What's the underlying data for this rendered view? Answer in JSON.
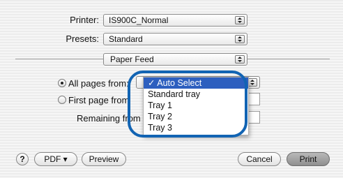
{
  "printer": {
    "label": "Printer:",
    "value": "IS900C_Normal"
  },
  "presets": {
    "label": "Presets:",
    "value": "Standard"
  },
  "panel": {
    "value": "Paper Feed"
  },
  "options": {
    "all_pages": "All pages from:",
    "first_page": "First page from",
    "remaining": "Remaining from"
  },
  "menu": {
    "items": [
      "✓ Auto Select",
      "Standard tray",
      "Tray 1",
      "Tray 2",
      "Tray 3"
    ],
    "selected_index": 0
  },
  "buttons": {
    "help": "?",
    "pdf": "PDF ▾",
    "preview": "Preview",
    "cancel": "Cancel",
    "print": "Print"
  },
  "colors": {
    "highlight": "#2d5fbf",
    "annotation_ring": "#1264b3"
  }
}
